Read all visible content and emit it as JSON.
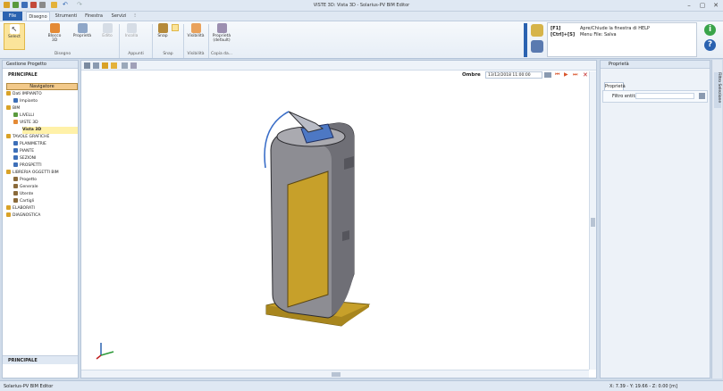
{
  "window": {
    "title": "VISTE 3D: Vista 3D - Solarius-PV BIM Editor"
  },
  "menu": {
    "file": "File",
    "tabs": [
      "Disegno",
      "Strumenti",
      "Finestra",
      "Servizi"
    ]
  },
  "ribbon": {
    "select": "Select",
    "blocco": "Blocco 3D",
    "proprieta": "Proprietà",
    "edito": "Edito",
    "incolla": "Incolla",
    "snap": "Snap",
    "visibilita": "Visibilità",
    "prop_default": "Proprietà (default)",
    "groups": {
      "disegno": "Disegno",
      "appunti": "Appunti",
      "snap": "Snap",
      "visibilita": "Visibilità",
      "copia": "Copia da..."
    }
  },
  "help": {
    "key1": "[F1]",
    "key2": "[Ctrl]+[S]",
    "line1": "Apre/Chiude la finestra di HELP",
    "line2": "Menu File: Salva"
  },
  "left": {
    "header": "Gestione Progetto",
    "principale": "PRINCIPALE",
    "navigator": "Navigatore",
    "footer": "PRINCIPALE",
    "tree": [
      "Dati IMPIANTO",
      "Impianto",
      "BIM",
      "LIVELLI",
      "VISTE 3D",
      "Vista 3D",
      "TAVOLE GRAFICHE",
      "PLANIMETRIE",
      "PIANTE",
      "SEZIONI",
      "PROSPETTI",
      "LIBRERIA OGGETTI BIM",
      "Progetto",
      "Generale",
      "Utente",
      "Cartigli",
      "ELABORATI",
      "DIAGNOSTICA"
    ]
  },
  "view": {
    "ombre": "Ombre",
    "date": "13/12/2018 11:00:00"
  },
  "right": {
    "header": "Proprietà",
    "tab": "Proprietà",
    "filter_label": "Filtro entità",
    "vtab": "Filtro Selezione"
  },
  "status": {
    "app": "Solarius-PV BIM Editor",
    "coords": "X: 7.39 - Y: 19.66 - Z: 0.00 [m]"
  },
  "colors": {
    "accent": "#2a62b0",
    "panel": "#d4a42a"
  }
}
